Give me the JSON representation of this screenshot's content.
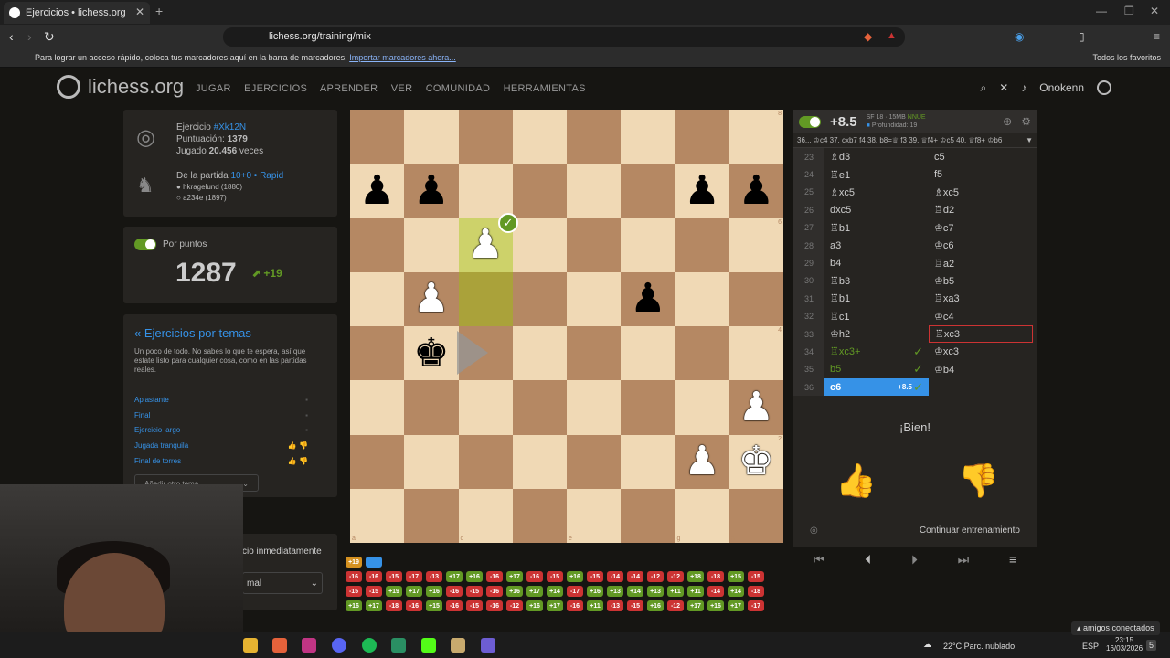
{
  "browser": {
    "tab_title": "Ejercicios • lichess.org",
    "url": "lichess.org/training/mix",
    "bookmarks_hint": "Para lograr un acceso rápido, coloca tus marcadores aquí en la barra de marcadores.",
    "bookmarks_import": "Importar marcadores ahora...",
    "all_favorites": "Todos los favoritos"
  },
  "site": {
    "logo": "lichess.org",
    "nav": [
      "JUGAR",
      "EJERCICIOS",
      "APRENDER",
      "VER",
      "COMUNIDAD",
      "HERRAMIENTAS"
    ],
    "username": "Onokenn"
  },
  "puzzle": {
    "label": "Ejercicio",
    "id": "#Xk12N",
    "rating_label": "Puntuación:",
    "rating": "1379",
    "played_label": "Jugado",
    "played": "20.456",
    "played_suffix": "veces",
    "game_label": "De la partida",
    "game_time": "10+0 • Rapid",
    "white_player": "hkragelund (1880)",
    "black_player": "a234e (1897)"
  },
  "score": {
    "label": "Por puntos",
    "rating": "1287",
    "diff": "+19"
  },
  "themes": {
    "back_link": "« Ejercicios por temas",
    "description": "Un poco de todo. No sabes lo que te espera, así que estate listo para cualquier cosa, como en las partidas reales.",
    "items": [
      "Aplastante",
      "Final",
      "Ejercicio largo",
      "Jugada tranquila",
      "Final de torres"
    ],
    "add_placeholder": "Añadir otro tema",
    "auto_next": "cio inmediatamente",
    "difficulty": "mal"
  },
  "board": {
    "ranks": [
      "8",
      "7",
      "6",
      "5",
      "4",
      "3",
      "2",
      "1"
    ],
    "files": [
      "a",
      "b",
      "c",
      "d",
      "e",
      "f",
      "g",
      "h"
    ]
  },
  "engine": {
    "eval": "+8.5",
    "name": "SF 18 · 15MB",
    "nnue": "NNUE",
    "depth": "Profundidad: 19",
    "pv": "36... ♔c4 37. cxb7 f4 38. b8=♕ f3 39. ♕f4+ ♔c5 40. ♕f8+ ♔b6"
  },
  "moves": [
    {
      "n": "23",
      "w": "♗d3",
      "b": "c5"
    },
    {
      "n": "24",
      "w": "♖e1",
      "b": "f5"
    },
    {
      "n": "25",
      "w": "♗xc5",
      "b": "♗xc5"
    },
    {
      "n": "26",
      "w": "dxc5",
      "b": "♖d2"
    },
    {
      "n": "27",
      "w": "♖b1",
      "b": "♔c7"
    },
    {
      "n": "28",
      "w": "a3",
      "b": "♔c6"
    },
    {
      "n": "29",
      "w": "b4",
      "b": "♖a2"
    },
    {
      "n": "30",
      "w": "♖b3",
      "b": "♔b5"
    },
    {
      "n": "31",
      "w": "♖b1",
      "b": "♖xa3"
    },
    {
      "n": "32",
      "w": "♖c1",
      "b": "♔c4"
    },
    {
      "n": "33",
      "w": "♔h2",
      "b": "♖xc3"
    },
    {
      "n": "34",
      "w": "♖xc3+",
      "b": "♔xc3"
    },
    {
      "n": "35",
      "w": "b5",
      "b": "♔b4"
    },
    {
      "n": "36",
      "w": "c6",
      "b": "",
      "eval": "+8.5"
    }
  ],
  "feedback": {
    "result": "¡Bien!",
    "continue": "Continuar entrenamiento"
  },
  "history": {
    "first": [
      "+19",
      ""
    ],
    "rows": [
      [
        "-16",
        "-16",
        "-15",
        "-17",
        "-13",
        "+17",
        "+16",
        "-16",
        "+17",
        "-16",
        "-15",
        "+16",
        "-15",
        "-14",
        "-14",
        "-12",
        "-12",
        "+18",
        "-18",
        "+15",
        "-15"
      ],
      [
        "-15",
        "-15",
        "+19",
        "+17",
        "+16",
        "-16",
        "-15",
        "-16",
        "+16",
        "+17",
        "+14",
        "-17",
        "+16",
        "+13",
        "+14",
        "+13",
        "+11",
        "+11",
        "-14",
        "+14",
        "-18"
      ],
      [
        "+16",
        "+17",
        "-18",
        "-16",
        "+15",
        "-16",
        "-15",
        "-16",
        "-12",
        "+16",
        "+17",
        "-16",
        "+11",
        "-13",
        "-15",
        "+16",
        "-12",
        "+17",
        "+16",
        "+17",
        "-17"
      ]
    ]
  },
  "taskbar": {
    "weather": "22°C  Parc. nublado",
    "lang": "ESP",
    "time": "23:15",
    "date": "16/03/2026",
    "friends": "amigos conectados",
    "notif": "5"
  }
}
